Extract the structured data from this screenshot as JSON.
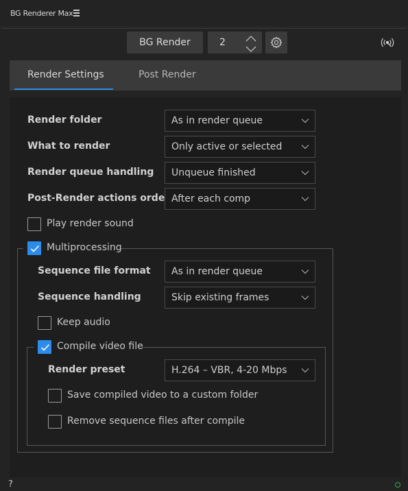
{
  "window": {
    "title": "BG Renderer Max"
  },
  "toolbar": {
    "render_label": "BG Render",
    "workers_value": "2"
  },
  "tabs": [
    {
      "label": "Render Settings",
      "active": true
    },
    {
      "label": "Post Render",
      "active": false
    }
  ],
  "settings": {
    "render_folder": {
      "label": "Render folder",
      "value": "As in render queue"
    },
    "what_to_render": {
      "label": "What to render",
      "value": "Only active or selected"
    },
    "queue_handling": {
      "label": "Render queue handling",
      "value": "Unqueue finished"
    },
    "post_render_order": {
      "label": "Post-Render actions order",
      "value": "After each comp"
    },
    "play_sound": {
      "label": "Play render sound",
      "checked": false
    },
    "multiprocessing": {
      "label": "Multiprocessing",
      "checked": true,
      "sequence_format": {
        "label": "Sequence file format",
        "value": "As in render queue"
      },
      "sequence_handling": {
        "label": "Sequence handling",
        "value": "Skip existing frames"
      },
      "keep_audio": {
        "label": "Keep audio",
        "checked": false
      },
      "compile_video": {
        "label": "Compile video file",
        "checked": true,
        "render_preset": {
          "label": "Render preset",
          "value": "H.264 – VBR, 4-20 Mbps"
        },
        "custom_folder": {
          "label": "Save compiled video to a custom folder",
          "checked": false
        },
        "remove_sequence": {
          "label": "Remove sequence files after compile",
          "checked": false
        }
      }
    }
  },
  "statusbar": {
    "help": "?"
  },
  "colors": {
    "accent": "#2d8ceb",
    "status_ok": "#2fae4a"
  }
}
